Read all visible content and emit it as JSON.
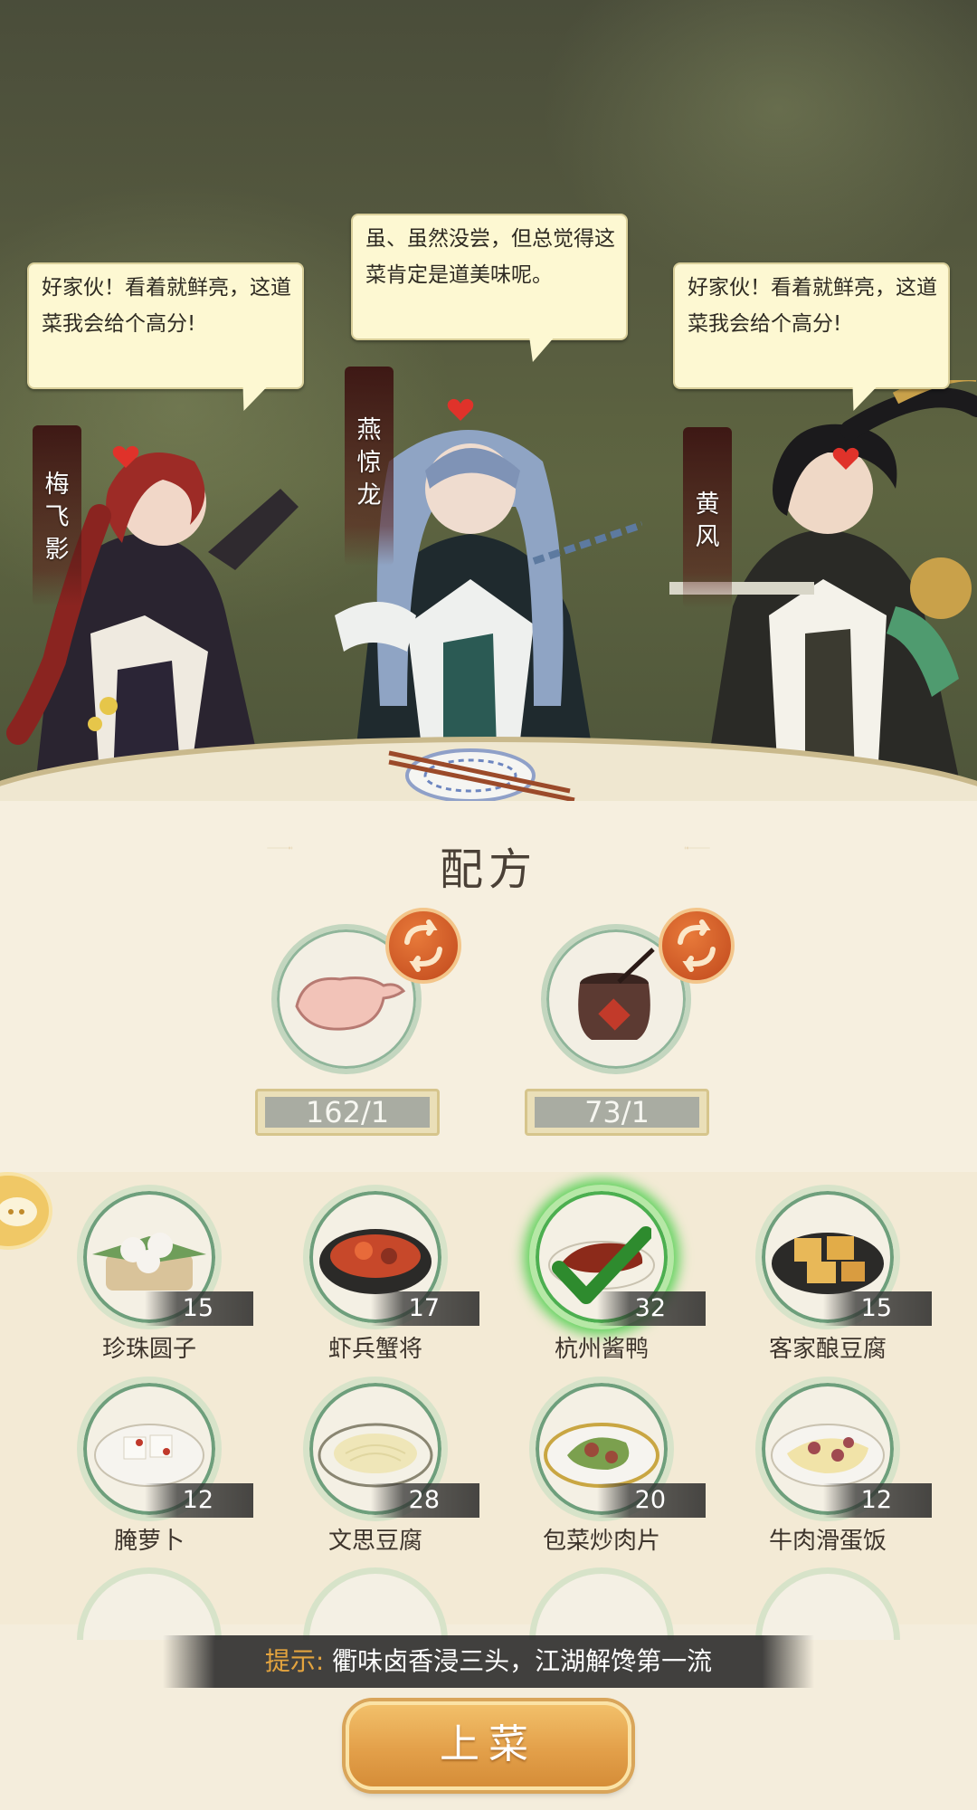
{
  "characters": [
    {
      "name": "梅飞影",
      "speech": "好家伙！看着就鲜亮，这道菜我会给个高分!"
    },
    {
      "name": "燕惊龙",
      "speech": "虽、虽然没尝，但总觉得这菜肯定是道美味呢。"
    },
    {
      "name": "黄风",
      "speech": "好家伙！看着就鲜亮，这道菜我会给个高分!"
    }
  ],
  "recipe": {
    "title": "配方",
    "ingredients": [
      {
        "icon": "raw-duck-icon",
        "quantity": "162/1"
      },
      {
        "icon": "sauce-jar-icon",
        "quantity": "73/1"
      }
    ]
  },
  "dishes": [
    {
      "name": "珍珠圆子",
      "count": "15",
      "selected": false
    },
    {
      "name": "虾兵蟹将",
      "count": "17",
      "selected": false
    },
    {
      "name": "杭州酱鸭",
      "count": "32",
      "selected": true
    },
    {
      "name": "客家酿豆腐",
      "count": "15",
      "selected": false
    },
    {
      "name": "腌萝卜",
      "count": "12",
      "selected": false
    },
    {
      "name": "文思豆腐",
      "count": "28",
      "selected": false
    },
    {
      "name": "包菜炒肉片",
      "count": "20",
      "selected": false
    },
    {
      "name": "牛肉滑蛋饭",
      "count": "12",
      "selected": false
    }
  ],
  "hint": {
    "label": "提示:",
    "text": "衢味卤香浸三头，江湖解馋第一流"
  },
  "serve_button": "上菜",
  "colors": {
    "accent": "#e4a43e",
    "selected_glow": "#5fd25c",
    "plate_ring": "#6e9f7c"
  }
}
